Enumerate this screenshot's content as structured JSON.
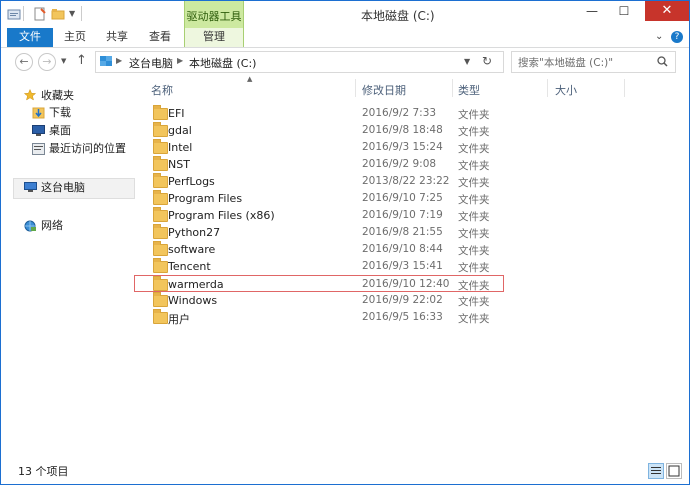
{
  "window": {
    "title": "本地磁盘 (C:)",
    "context_tab_header": "驱动器工具",
    "minimize": "—",
    "maximize": "☐",
    "close": "✕"
  },
  "ribbon": {
    "tabs": [
      "文件",
      "主页",
      "共享",
      "查看",
      "管理"
    ],
    "collapse_icon": "chevron-down-icon",
    "help_icon": "question-icon"
  },
  "nav": {
    "back": "←",
    "forward": "→",
    "up": "↑",
    "breadcrumb": [
      "这台电脑",
      "本地磁盘 (C:)"
    ],
    "search_placeholder": "搜索\"本地磁盘 (C:)\""
  },
  "sidebar": {
    "favorites_label": "收藏夹",
    "favorites": [
      "下载",
      "桌面",
      "最近访问的位置"
    ],
    "this_pc": "这台电脑",
    "network": "网络"
  },
  "columns": {
    "name": "名称",
    "date": "修改日期",
    "type": "类型",
    "size": "大小"
  },
  "files": [
    {
      "name": "EFI",
      "date": "2016/9/2 7:33",
      "type": "文件夹"
    },
    {
      "name": "gdal",
      "date": "2016/9/8 18:48",
      "type": "文件夹"
    },
    {
      "name": "Intel",
      "date": "2016/9/3 15:24",
      "type": "文件夹"
    },
    {
      "name": "NST",
      "date": "2016/9/2 9:08",
      "type": "文件夹"
    },
    {
      "name": "PerfLogs",
      "date": "2013/8/22 23:22",
      "type": "文件夹"
    },
    {
      "name": "Program Files",
      "date": "2016/9/10 7:25",
      "type": "文件夹"
    },
    {
      "name": "Program Files (x86)",
      "date": "2016/9/10 7:19",
      "type": "文件夹"
    },
    {
      "name": "Python27",
      "date": "2016/9/8 21:55",
      "type": "文件夹"
    },
    {
      "name": "software",
      "date": "2016/9/10 8:44",
      "type": "文件夹"
    },
    {
      "name": "Tencent",
      "date": "2016/9/3 15:41",
      "type": "文件夹"
    },
    {
      "name": "warmerda",
      "date": "2016/9/10 12:40",
      "type": "文件夹"
    },
    {
      "name": "Windows",
      "date": "2016/9/9 22:02",
      "type": "文件夹"
    },
    {
      "name": "用户",
      "date": "2016/9/5 16:33",
      "type": "文件夹"
    }
  ],
  "highlighted_row": "warmerda",
  "highlight_color": "#e06666",
  "status": {
    "count": "13 个项目"
  },
  "colors": {
    "accent": "#1979ca",
    "context_tab": "#cde9a0",
    "close": "#c7342b"
  }
}
